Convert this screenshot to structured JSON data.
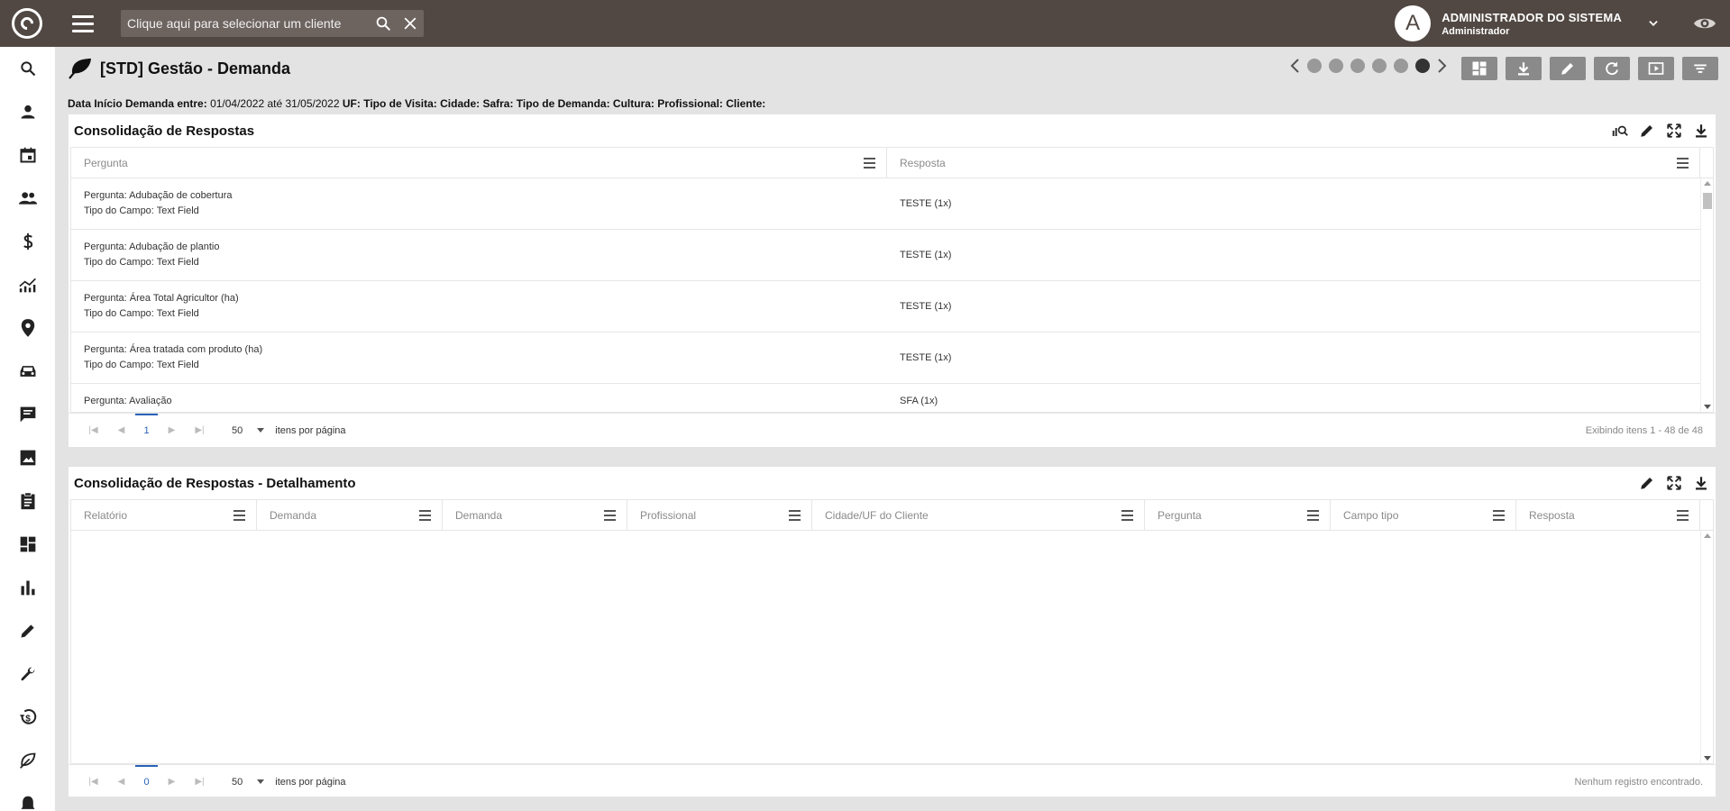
{
  "topbar": {
    "search_placeholder": "Clique aqui para selecionar um cliente",
    "avatar_letter": "A",
    "user_name": "ADMINISTRADOR DO SISTEMA",
    "user_role": "Administrador"
  },
  "sidebar": {
    "items": [
      "search-icon",
      "person-icon",
      "calendar-icon",
      "group-icon",
      "dollar-icon",
      "trending-icon",
      "location-pin-icon",
      "car-icon",
      "chat-icon",
      "gallery-icon",
      "clipboard-icon",
      "dashboard-icon",
      "bar-chart-icon",
      "pencil-icon",
      "wrench-icon",
      "money-history-icon",
      "leaf-icon",
      "bell-icon"
    ]
  },
  "page": {
    "title": "[STD] Gestão - Demanda",
    "carousel_active_index": 5,
    "carousel_count": 6
  },
  "filters": {
    "date_label": "Data Início Demanda entre:",
    "date_value": "01/04/2022 até 31/05/2022",
    "rest": "UF: Tipo de Visita: Cidade: Safra: Tipo de Demanda: Cultura: Profissional: Cliente:"
  },
  "panel1": {
    "title": "Consolidação de Respostas",
    "columns": [
      "Pergunta",
      "Resposta"
    ],
    "rows": [
      {
        "pergunta": "Pergunta: Adubação de cobertura",
        "tipo": "Tipo do Campo: Text Field",
        "resposta": "TESTE (1x)"
      },
      {
        "pergunta": "Pergunta: Adubação de plantio",
        "tipo": "Tipo do Campo: Text Field",
        "resposta": "TESTE (1x)"
      },
      {
        "pergunta": "Pergunta: Área Total Agricultor (ha)",
        "tipo": "Tipo do Campo: Text Field",
        "resposta": "TESTE (1x)"
      },
      {
        "pergunta": "Pergunta: Área tratada com produto (ha)",
        "tipo": "Tipo do Campo: Text Field",
        "resposta": "TESTE (1x)"
      },
      {
        "pergunta": "Pergunta: Avaliação",
        "tipo": "",
        "resposta": "SFA (1x)"
      }
    ],
    "pager": {
      "page": "1",
      "page_size": "50",
      "per_page_label": "itens por página",
      "info": "Exibindo itens 1 - 48 de 48"
    }
  },
  "panel2": {
    "title": "Consolidação de Respostas - Detalhamento",
    "columns": [
      "Relatório",
      "Demanda",
      "Demanda",
      "Profissional",
      "Cidade/UF do Cliente",
      "Pergunta",
      "Campo tipo",
      "Resposta"
    ],
    "pager": {
      "page": "0",
      "page_size": "50",
      "per_page_label": "itens por página",
      "info": "Nenhum registro encontrado."
    }
  }
}
